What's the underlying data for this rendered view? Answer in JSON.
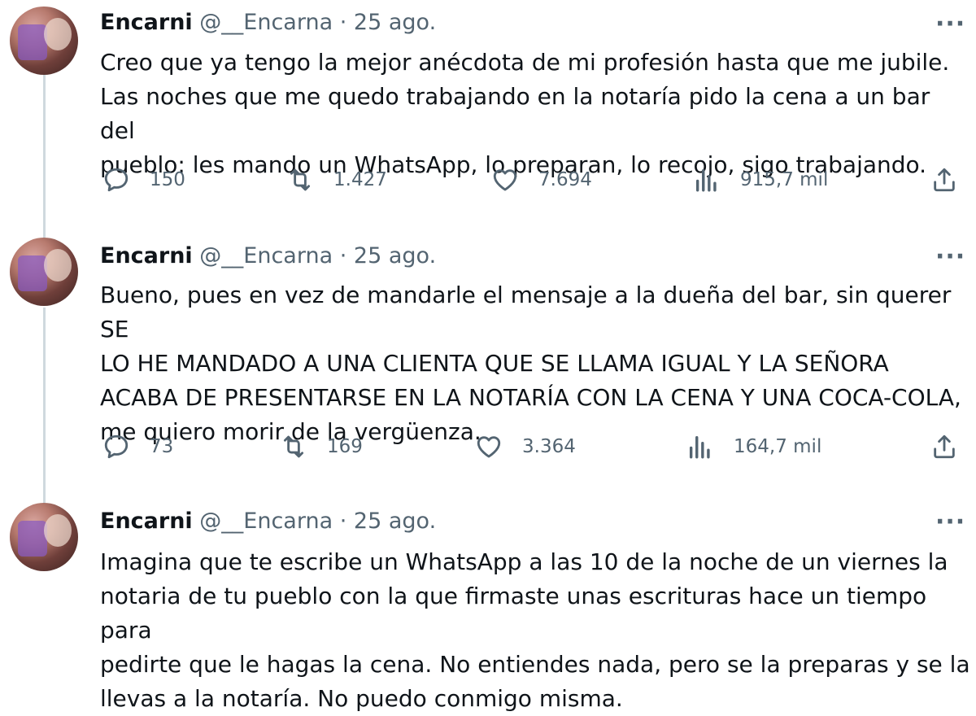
{
  "tweets": [
    {
      "name": "Encarni",
      "handle": "@__Encarna",
      "separator": "·",
      "date": "25 ago.",
      "text": "Creo que ya tengo la mejor anécdota de mi profesión hasta que me jubile.\nLas noches que me quedo trabajando en la notaría pido la cena a un bar del\npueblo: les mando un WhatsApp, lo preparan, lo recojo, sigo trabajando.",
      "replies": "150",
      "retweets": "1.427",
      "likes": "7.694",
      "views": "915,7 mil"
    },
    {
      "name": "Encarni",
      "handle": "@__Encarna",
      "separator": "·",
      "date": "25 ago.",
      "text": "Bueno, pues en vez de mandarle el mensaje a la dueña del bar, sin querer SE\nLO HE MANDADO A UNA CLIENTA QUE SE LLAMA IGUAL Y LA SEÑORA\nACABA DE PRESENTARSE EN LA NOTARÍA CON LA CENA Y UNA COCA-COLA,\nme quiero morir de la vergüenza.",
      "replies": "73",
      "retweets": "169",
      "likes": "3.364",
      "views": "164,7 mil"
    },
    {
      "name": "Encarni",
      "handle": "@__Encarna",
      "separator": "·",
      "date": "25 ago.",
      "text": "Imagina que te escribe un WhatsApp a las 10 de la noche de un viernes la\nnotaria de tu pueblo con la que firmaste unas escrituras hace un tiempo para\npedirte que le hagas la cena. No entiendes nada, pero se la preparas y se la\nllevas a la notaría.  No puedo conmigo misma."
    }
  ],
  "icons": {
    "reply": "reply-icon",
    "retweet": "retweet-icon",
    "like": "heart-icon",
    "views": "views-icon",
    "share": "share-icon",
    "more": "more-icon"
  },
  "more_label": "···"
}
